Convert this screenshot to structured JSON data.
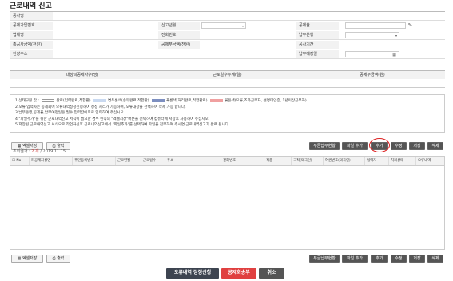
{
  "title": "근로내역 신고",
  "form": {
    "row1": {
      "label1": "공사명"
    },
    "row2": {
      "label1": "공제가입번호",
      "label2": "신고년월",
      "label3": "공제율",
      "pct": "%"
    },
    "row3": {
      "label1": "업체명",
      "label2": "전화번호",
      "label3": "납부은행"
    },
    "row4": {
      "label1": "총공사금액(천원)",
      "label2": "공제부금액(천원)",
      "label3": "공사기간"
    },
    "row5": {
      "label1": "현장주소",
      "label3": "납부예정일"
    }
  },
  "summary": {
    "col1": "대상피공제자수(명)",
    "col2": "근로일수누계(일)",
    "col3": "공제부금액(원)"
  },
  "notes": {
    "line1_prefix": "1.상태구분 값 :",
    "legend": [
      {
        "text": "완료(입력완료,적합판)",
        "color": "#ffffff"
      },
      {
        "text": "연두론색(송부완료,적합판)",
        "color": "#c9d9f0"
      },
      {
        "text": "푸른색(처리완료,적합판료)",
        "color": "#7d8fc0"
      },
      {
        "text": "붉은색(오류,조과근무자, 설명미인증, 1년이상근무자)",
        "color": "#f0a0a0"
      }
    ],
    "line2": "2.오류 입력자는 공제회에 오류내역정정신청하여 정정 처리가 가능하며, 오류대상을 선택하여 삭제 가능 합니다.",
    "line3": "3.납부은행,공제율,납부예정일은 필수 입력값이므로 입력하여 주십시오.",
    "line4": "4.\"파일추가\"를 위한 근로내역신고 서식이 필요한 경우 왼쪽의 \"엑셀저장\"버튼을 선택하여 컴퓨터에 저장후 사용하여 주십시오.",
    "line5": "5.저장된 근로내역신고 서식으로 작업하신후 근로내역신고에서 \"파일추가\"를 선택하여 파일을 첨부하여 주시면 근로내역신고가 완료 됩니다."
  },
  "toolbar": {
    "excel_save": "엑셀저장",
    "print": "출력",
    "buttons": [
      "부금납부현황",
      "파일 추가",
      "추가",
      "수정",
      "저장",
      "삭제"
    ]
  },
  "result": {
    "label": "조회결과 :",
    "count": "2 개",
    "date": "/ 2019.11.15"
  },
  "grid": {
    "columns": [
      "No",
      "피공제자성명",
      "주민등록번호",
      "근로년월",
      "근로일수",
      "주소",
      "전화번호",
      "직종",
      "국적(외국인)",
      "여권번호(외국인)",
      "입력자",
      "처리상태",
      "오류내역"
    ]
  },
  "bottom": {
    "error_fix": "오류내역 정정신청",
    "send": "공제회송부",
    "cancel": "취소"
  }
}
